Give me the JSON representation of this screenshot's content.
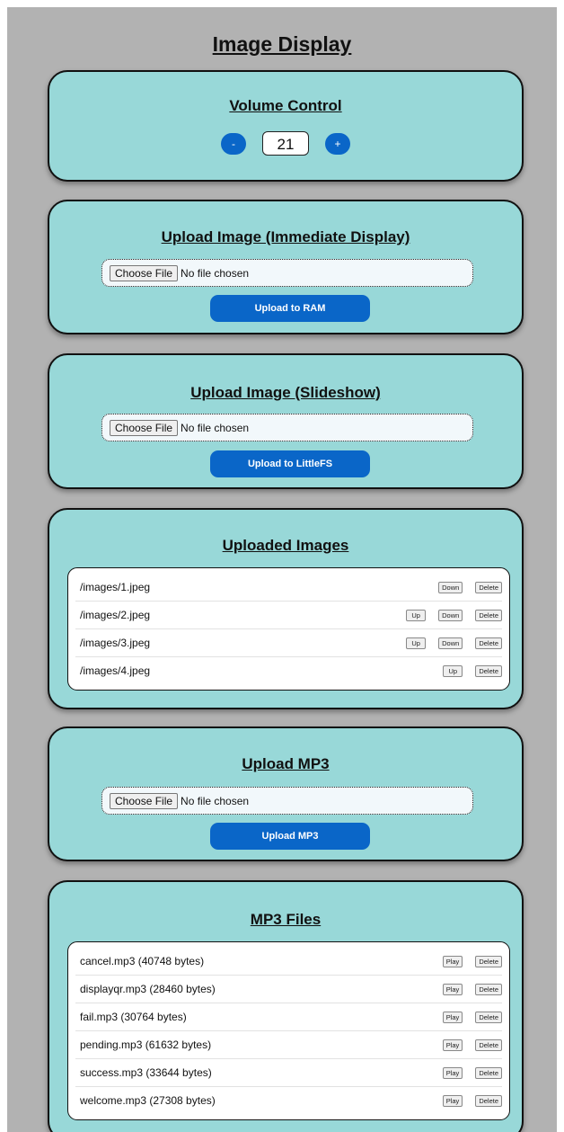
{
  "page": {
    "title": "Image Display"
  },
  "volume": {
    "title": "Volume Control",
    "minus_label": "-",
    "value": "21",
    "plus_label": "+"
  },
  "upload_ram": {
    "title": "Upload Image (Immediate Display)",
    "choose_label": "Choose File",
    "file_status": "No file chosen",
    "button_label": "Upload to RAM"
  },
  "upload_slideshow": {
    "title": "Upload Image (Slideshow)",
    "choose_label": "Choose File",
    "file_status": "No file chosen",
    "button_label": "Upload to LittleFS"
  },
  "uploaded_images": {
    "title": "Uploaded Images",
    "items": [
      {
        "name": "/images/1.jpeg",
        "up": "",
        "down": "Down",
        "delete": "Delete"
      },
      {
        "name": "/images/2.jpeg",
        "up": "Up",
        "down": "Down",
        "delete": "Delete"
      },
      {
        "name": "/images/3.jpeg",
        "up": "Up",
        "down": "Down",
        "delete": "Delete"
      },
      {
        "name": "/images/4.jpeg",
        "up": "Up",
        "down": "",
        "delete": "Delete"
      }
    ]
  },
  "upload_mp3": {
    "title": "Upload MP3",
    "choose_label": "Choose File",
    "file_status": "No file chosen",
    "button_label": "Upload MP3"
  },
  "mp3_files": {
    "title": "MP3 Files",
    "play_label": "Play",
    "delete_label": "Delete",
    "items": [
      {
        "name": "cancel.mp3 (40748 bytes)"
      },
      {
        "name": "displayqr.mp3 (28460 bytes)"
      },
      {
        "name": "fail.mp3 (30764 bytes)"
      },
      {
        "name": "pending.mp3 (61632 bytes)"
      },
      {
        "name": "success.mp3 (33644 bytes)"
      },
      {
        "name": "welcome.mp3 (27308 bytes)"
      }
    ]
  },
  "colors": {
    "page_background": "#b2b2b2",
    "card_background": "#98d8d8",
    "accent_blue": "#0a66c8"
  }
}
